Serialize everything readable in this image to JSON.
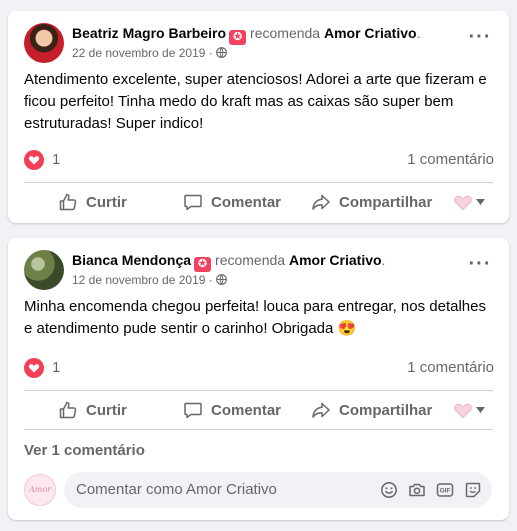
{
  "posts": [
    {
      "author": "Beatriz Magro Barbeiro",
      "verb": "recomenda",
      "page": "Amor Criativo",
      "date": "22 de novembro de 2019",
      "text": "Atendimento excelente, super atenciosos!  Adorei a arte que fizeram e ficou perfeito! Tinha medo do kraft mas as caixas são super bem estruturadas! Super indico!",
      "reactions": "1",
      "comments": "1 comentário"
    },
    {
      "author": "Bianca Mendonça",
      "verb": "recomenda",
      "page": "Amor Criativo",
      "date": "12 de novembro de 2019",
      "text": "Minha encomenda chegou perfeita!  louca para entregar, nos detalhes e atendimento pude sentir o carinho! Obrigada 😍",
      "reactions": "1",
      "comments": "1 comentário"
    }
  ],
  "actions": {
    "like": "Curtir",
    "comment": "Comentar",
    "share": "Compartilhar"
  },
  "view_comments": "Ver 1 comentário",
  "comment_placeholder": "Comentar como Amor Criativo",
  "page_avatar_text": "Amor",
  "icons": {
    "badge": "recommend-badge-icon",
    "more": "more-options-icon",
    "globe": "public-globe-icon",
    "heart": "love-reaction-icon",
    "like": "thumbs-up-icon",
    "comment": "comment-bubble-icon",
    "share": "share-arrow-icon",
    "emoji": "emoji-icon",
    "camera": "camera-icon",
    "gif": "gif-icon",
    "sticker": "sticker-icon"
  },
  "colors": {
    "background": "#f0f2f5",
    "card": "#ffffff",
    "secondary_text": "#65676b",
    "love": "#f33e58",
    "badge": "#f3425f"
  }
}
